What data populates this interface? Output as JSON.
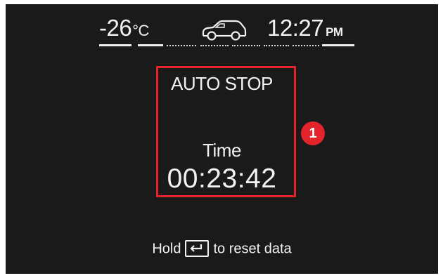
{
  "status_bar": {
    "temperature": "-26",
    "temperature_unit": "°C",
    "vehicle_icon": "car-icon",
    "clock_time": "12:27",
    "clock_period": "PM"
  },
  "panel": {
    "title": "AUTO STOP",
    "time_label": "Time",
    "time_value": "00:23:42",
    "callout_number": "1",
    "highlight_color": "#e3242b"
  },
  "footer": {
    "hint_prefix": "Hold",
    "hint_key_icon": "enter-key-icon",
    "hint_suffix": "to reset data"
  }
}
